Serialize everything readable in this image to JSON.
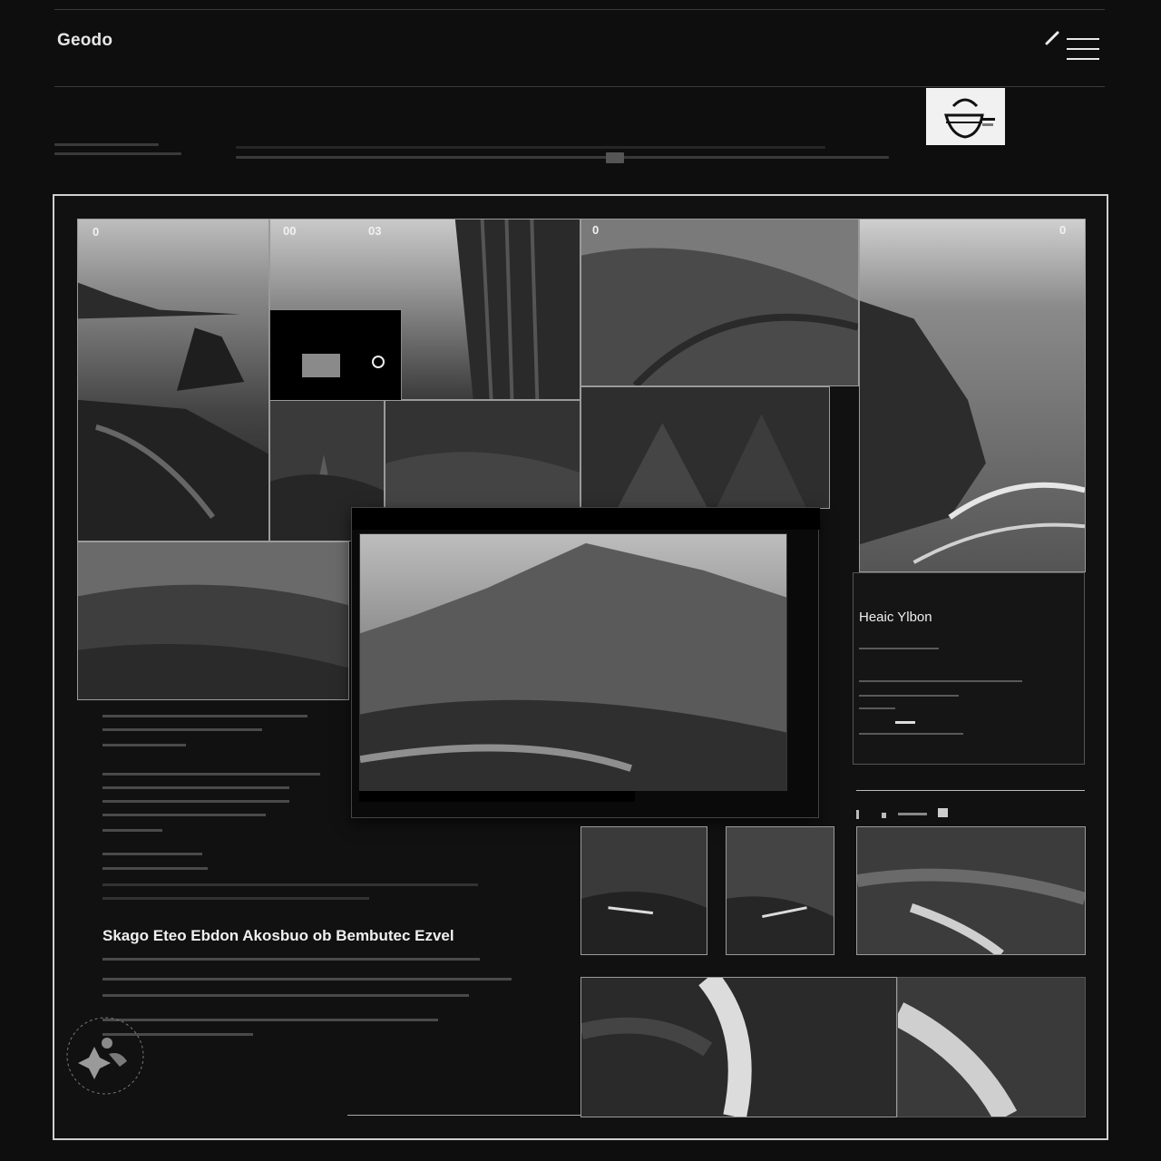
{
  "app": {
    "brand": "Geodo"
  },
  "header": {
    "icons": [
      "pen-icon",
      "menu-icon"
    ],
    "logo_icon": "bowl-logo-icon"
  },
  "gallery": {
    "photo_top_left_label": "0",
    "photo_tile_label_a": "00",
    "photo_tile_label_b": "03",
    "photo_cliff_label": "0",
    "photo_coast_label": "0"
  },
  "info_card": {
    "title": "Heaic Ylbon"
  },
  "article": {
    "headline": "Skago Eteo Ebdon  Akosbuo ob Bembutec Ezvel"
  },
  "colors": {
    "background": "#0e0e0e",
    "frame_border": "#cfcfcf",
    "text": "#d8d8d8"
  }
}
